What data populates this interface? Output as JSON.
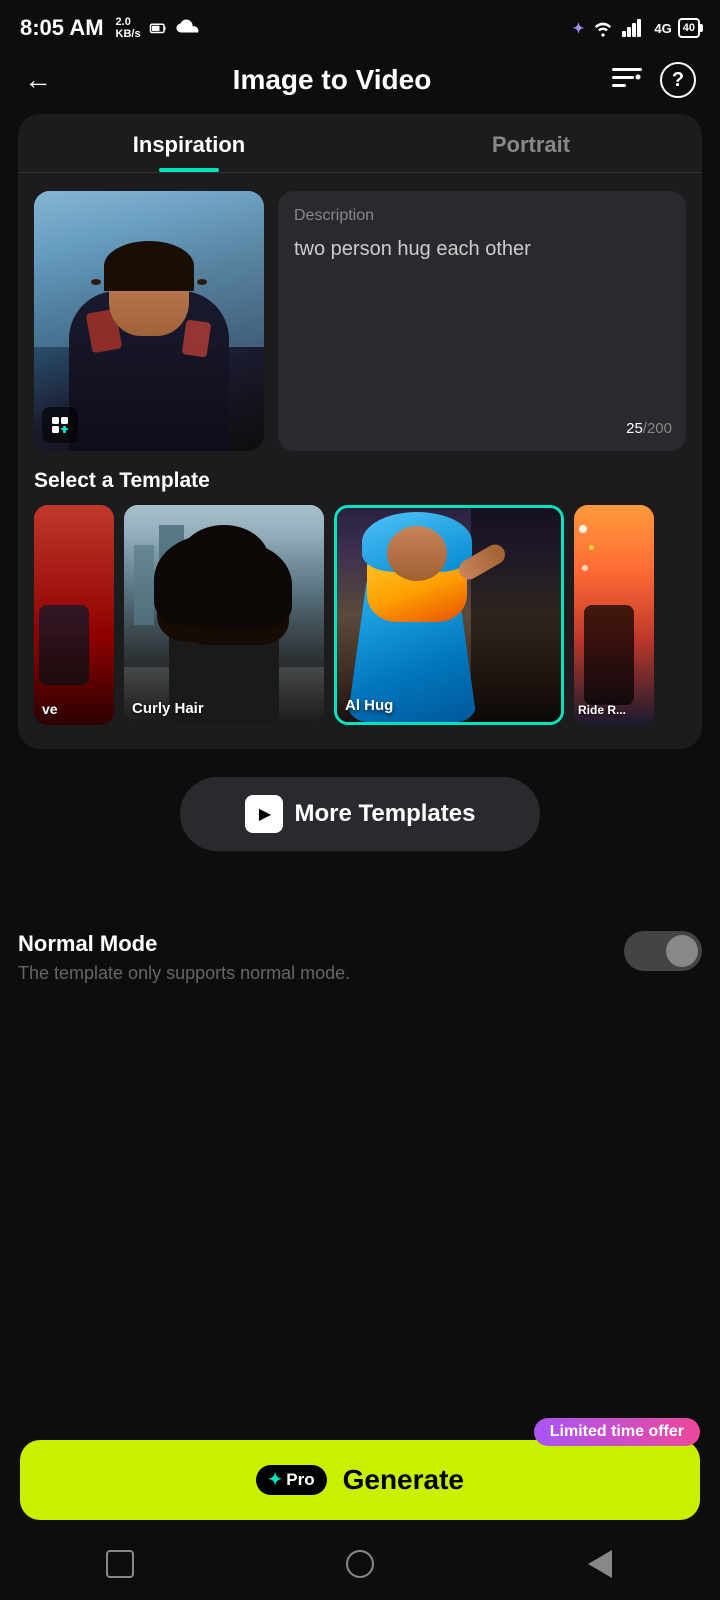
{
  "statusBar": {
    "time": "8:05 AM",
    "speed": "2.0\nKB/s",
    "battery": "40"
  },
  "header": {
    "title": "Image to Video",
    "backLabel": "←"
  },
  "tabs": [
    {
      "id": "inspiration",
      "label": "Inspiration",
      "active": true
    },
    {
      "id": "portrait",
      "label": "Portrait",
      "active": false
    }
  ],
  "description": {
    "label": "Description",
    "text": "two person hug each other",
    "current": "25",
    "max": "200"
  },
  "selectTemplate": {
    "label": "Select a Template"
  },
  "templates": [
    {
      "id": "t1",
      "label": "ve",
      "selected": false
    },
    {
      "id": "t2",
      "label": "Curly Hair",
      "selected": false
    },
    {
      "id": "t3",
      "label": "Al Hug",
      "selected": true
    },
    {
      "id": "t4",
      "label": "Ride R...",
      "selected": false
    }
  ],
  "moreTemplates": {
    "label": "More Templates"
  },
  "normalMode": {
    "title": "Normal Mode",
    "description": "The template only supports normal mode.",
    "enabled": false
  },
  "limitedOffer": {
    "label": "Limited time offer"
  },
  "generateButton": {
    "proLabel": "Pro",
    "label": "Generate"
  },
  "bottomNav": {
    "items": [
      "square",
      "circle",
      "triangle"
    ]
  }
}
